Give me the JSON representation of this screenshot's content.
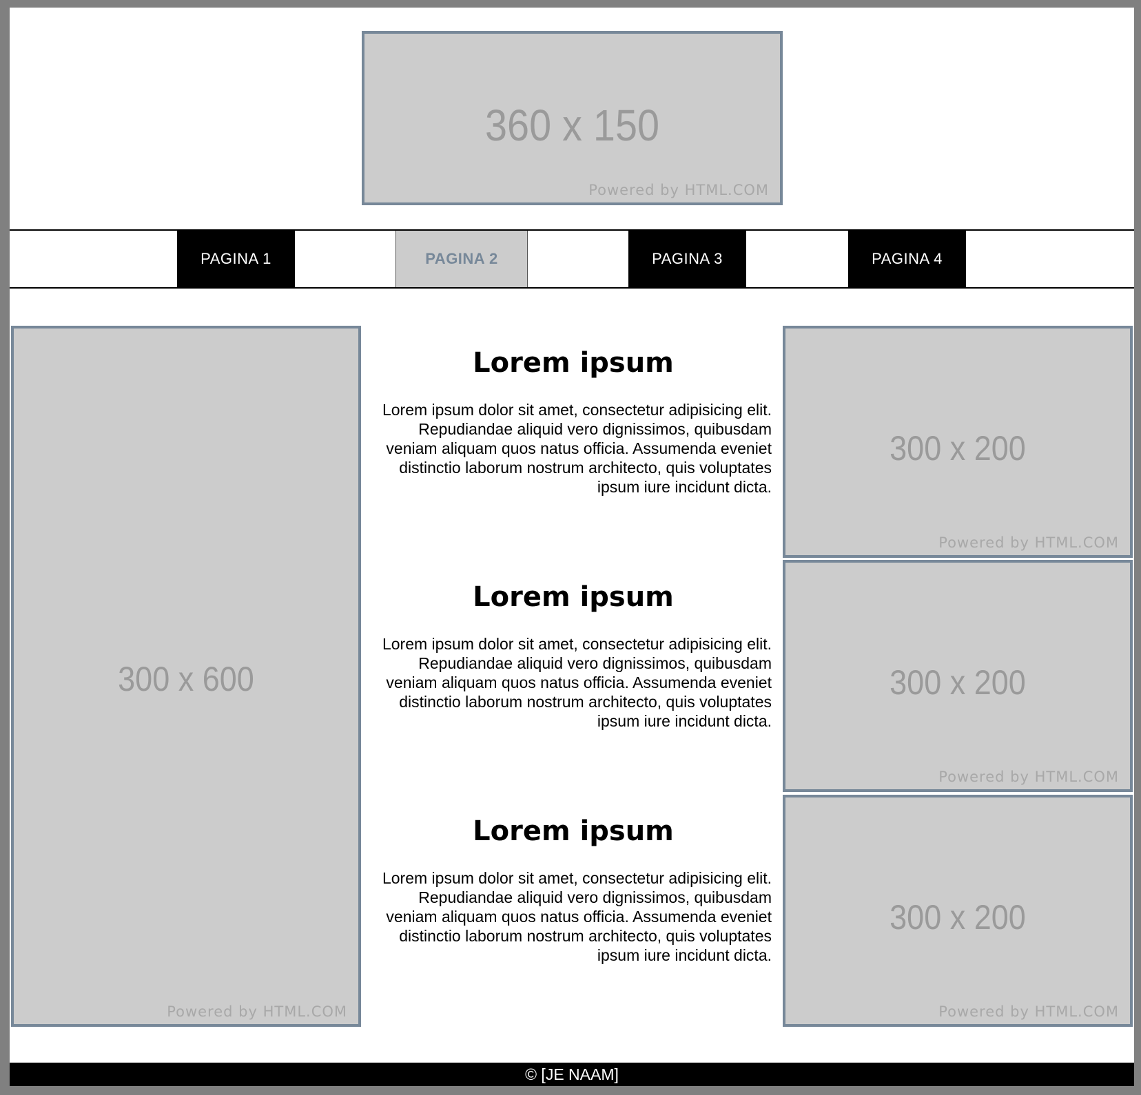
{
  "header": {
    "banner": {
      "size_text": "360 x 150",
      "powered_text": "Powered by HTML.COM"
    }
  },
  "nav": {
    "items": [
      {
        "label": "PAGINA 1",
        "active": false
      },
      {
        "label": "PAGINA 2",
        "active": true
      },
      {
        "label": "PAGINA 3",
        "active": false
      },
      {
        "label": "PAGINA 4",
        "active": false
      }
    ]
  },
  "left_ad": {
    "size_text": "300 x 600",
    "powered_text": "Powered by HTML.COM"
  },
  "right_ads": [
    {
      "size_text": "300 x 200",
      "powered_text": "Powered by HTML.COM"
    },
    {
      "size_text": "300 x 200",
      "powered_text": "Powered by HTML.COM"
    },
    {
      "size_text": "300 x 200",
      "powered_text": "Powered by HTML.COM"
    }
  ],
  "articles": [
    {
      "title": "Lorem ipsum",
      "body": "Lorem ipsum dolor sit amet, consectetur adipisicing elit. Repudiandae aliquid vero dignissimos, quibusdam veniam aliquam quos natus officia. Assumenda eveniet distinctio laborum nostrum architecto, quis voluptates ipsum iure incidunt dicta."
    },
    {
      "title": "Lorem ipsum",
      "body": "Lorem ipsum dolor sit amet, consectetur adipisicing elit. Repudiandae aliquid vero dignissimos, quibusdam veniam aliquam quos natus officia. Assumenda eveniet distinctio laborum nostrum architecto, quis voluptates ipsum iure incidunt dicta."
    },
    {
      "title": "Lorem ipsum",
      "body": "Lorem ipsum dolor sit amet, consectetur adipisicing elit. Repudiandae aliquid vero dignissimos, quibusdam veniam aliquam quos natus officia. Assumenda eveniet distinctio laborum nostrum architecto, quis voluptates ipsum iure incidunt dicta."
    }
  ],
  "footer": {
    "text": "© [JE NAAM]"
  },
  "colors": {
    "placeholder_bg": "#cccccc",
    "placeholder_border": "#778899",
    "nav_dark": "#000000",
    "nav_active_bg": "#cccccc",
    "nav_active_text": "#778899",
    "outer_bg": "#808080"
  }
}
